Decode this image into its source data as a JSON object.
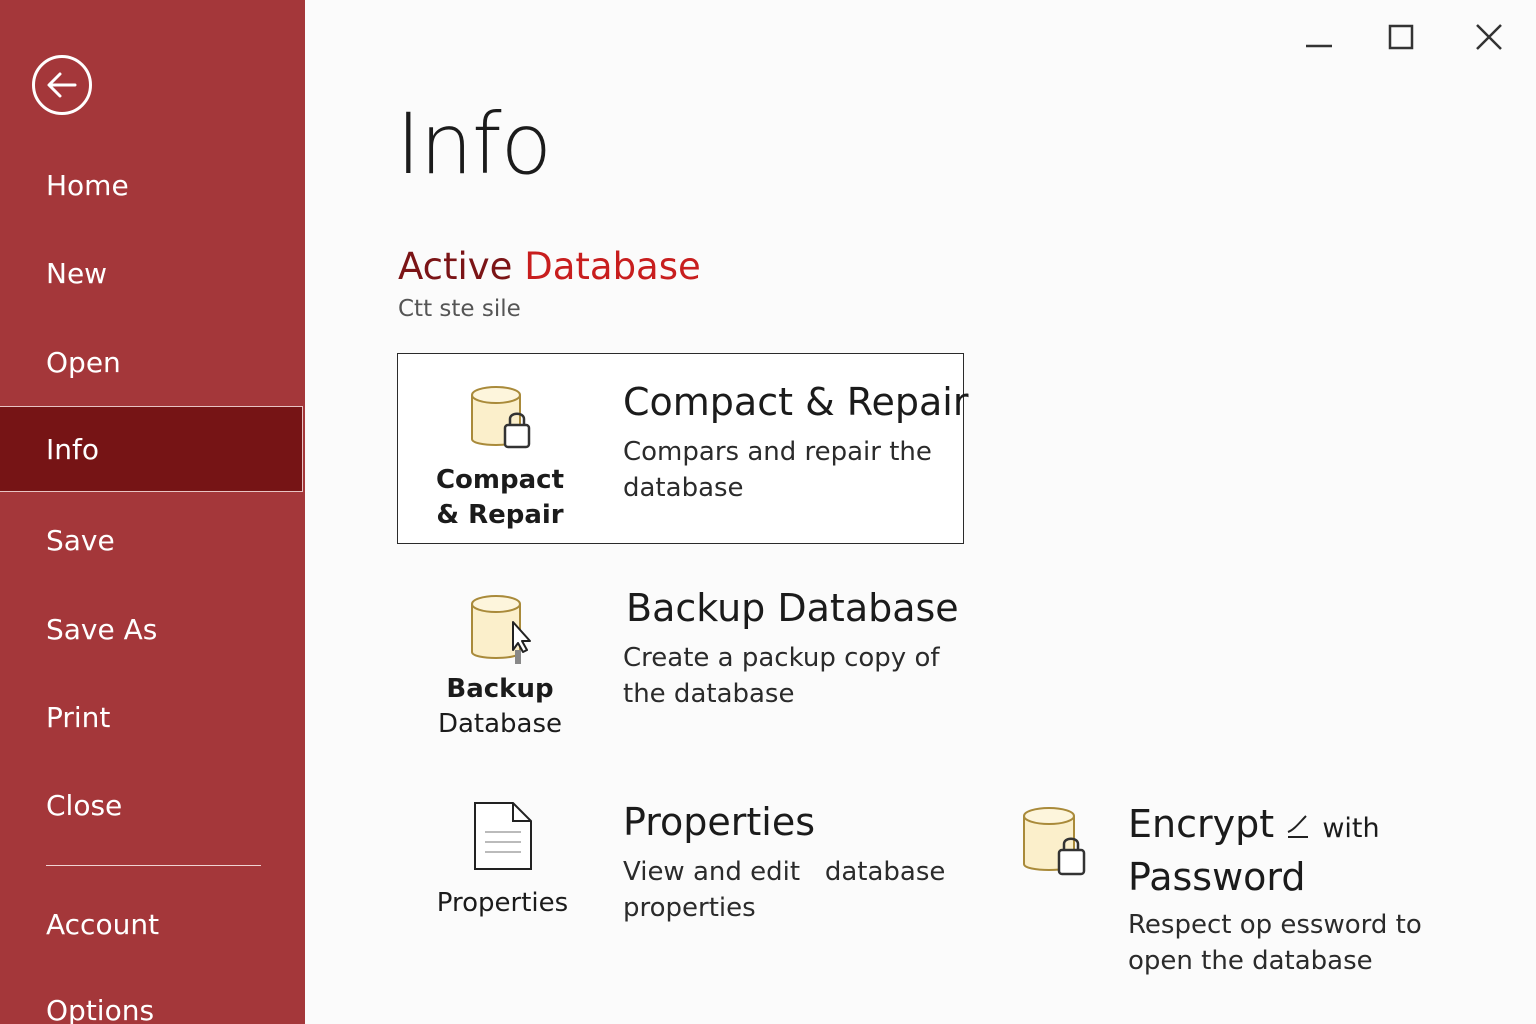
{
  "sidebar": {
    "back_label": "Back",
    "items": [
      {
        "label": "Home"
      },
      {
        "label": "New"
      },
      {
        "label": "Open"
      },
      {
        "label": "Info"
      },
      {
        "label": "Save"
      },
      {
        "label": "Save As"
      },
      {
        "label": "Print"
      },
      {
        "label": "Close"
      },
      {
        "label": "Account"
      },
      {
        "label": "Options"
      }
    ]
  },
  "window": {
    "minimize_icon": "minimize-icon",
    "maximize_icon": "maximize-icon",
    "close_icon": "close-icon"
  },
  "page": {
    "title": "Info",
    "section_title_part1": "Active",
    "section_title_part2": "Database",
    "section_subtitle": "Ctt ste sile"
  },
  "actions": {
    "compact": {
      "tile_line1": "Compact",
      "tile_line2": "& Repair",
      "heading": "Compact & Repair",
      "description_line1": "Compars and repair the",
      "description_line2": "database"
    },
    "backup": {
      "tile_line1": "Backup",
      "tile_line2": "Database",
      "heading": "Backup Database",
      "description_line1": "Create a packup copy of",
      "description_line2": "the database"
    },
    "properties": {
      "tile_label": "Properties",
      "heading": "Properties",
      "description_line1": "View and edit   database",
      "description_line2": "properties"
    },
    "encrypt": {
      "heading_line1": "Encrypt",
      "heading_with": "with",
      "heading_line2": "Password",
      "description_line1": "Respect op essword to",
      "description_line2": "open the database"
    }
  },
  "colors": {
    "sidebar": "#a4373a",
    "sidebar_active": "#761415",
    "accent": "#c81e1e",
    "section_title": "#7b1416"
  }
}
